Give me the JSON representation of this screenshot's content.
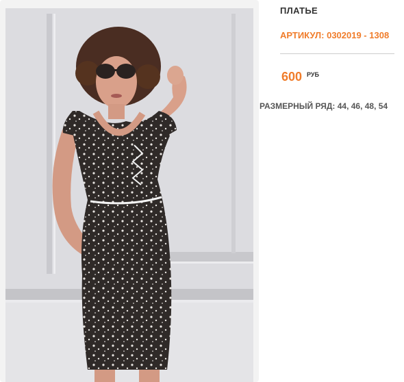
{
  "product": {
    "title": "ПЛАТЬЕ",
    "sku": "АРТИКУЛ: 0302019 - 1308",
    "price": "600",
    "currency": "РУБ",
    "sizes": "РАЗМЕРНЫЙ РЯД: 44, 46, 48, 54"
  },
  "colors": {
    "accent": "#f07c2a",
    "text_dark": "#333333",
    "divider": "#cccccc"
  }
}
